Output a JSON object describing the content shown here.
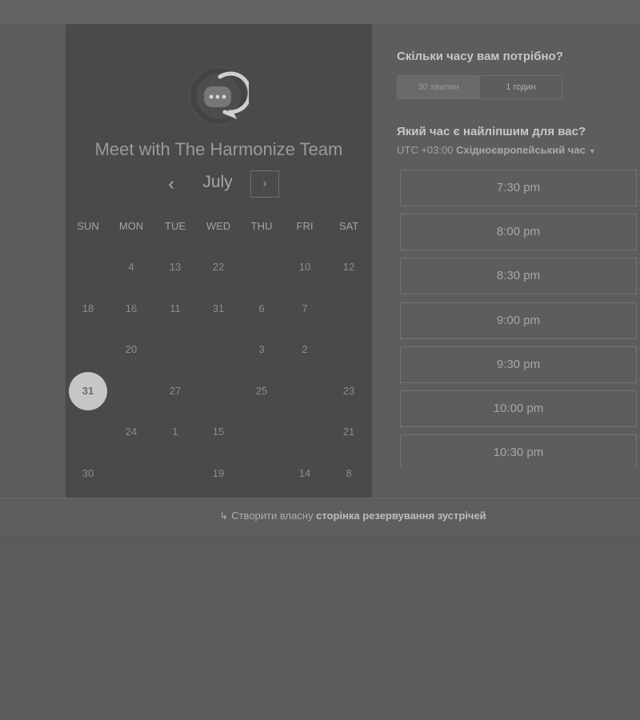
{
  "colors": {
    "accent": "#c6c6c6",
    "panel_left": "#4a4a4a",
    "panel_right": "#5d5d5d"
  },
  "header": {
    "title": "Meet with The Harmonize Team",
    "logo_icon": "chat-bubble-logo-icon"
  },
  "calendar": {
    "month": "July",
    "prev_icon": "‹",
    "next_icon": "›",
    "weekdays": [
      "SUN",
      "MON",
      "TUE",
      "WED",
      "THU",
      "FRI",
      "SAT"
    ],
    "rows": [
      [
        "",
        "4",
        "13",
        "22",
        "",
        "10",
        "12"
      ],
      [
        "18",
        "16",
        "11",
        "31",
        "6",
        "7",
        ""
      ],
      [
        "",
        "20",
        "",
        "",
        "3",
        "2",
        ""
      ],
      [
        "31",
        "",
        "27",
        "",
        "25",
        "",
        "23"
      ],
      [
        "",
        "24",
        "1",
        "15",
        "",
        "",
        "21"
      ],
      [
        "30",
        "",
        "",
        "19",
        "",
        "14",
        "8"
      ]
    ],
    "selected": "31"
  },
  "duration": {
    "question": "Скільки часу вам потрібно?",
    "options": [
      "30 хвилин",
      "1 годин"
    ]
  },
  "time": {
    "question": "Який час є найліпшим для вас?",
    "tz_offset": "UTC +03:00",
    "tz_name": "Східноєвропейський час",
    "slots": [
      "7:30 pm",
      "8:00 pm",
      "8:30 pm",
      "9:00 pm",
      "9:30 pm",
      "10:00 pm",
      "10:30 pm"
    ]
  },
  "footer": {
    "prefix": "Створити власну",
    "link": "сторінка резервування зустрічей"
  }
}
